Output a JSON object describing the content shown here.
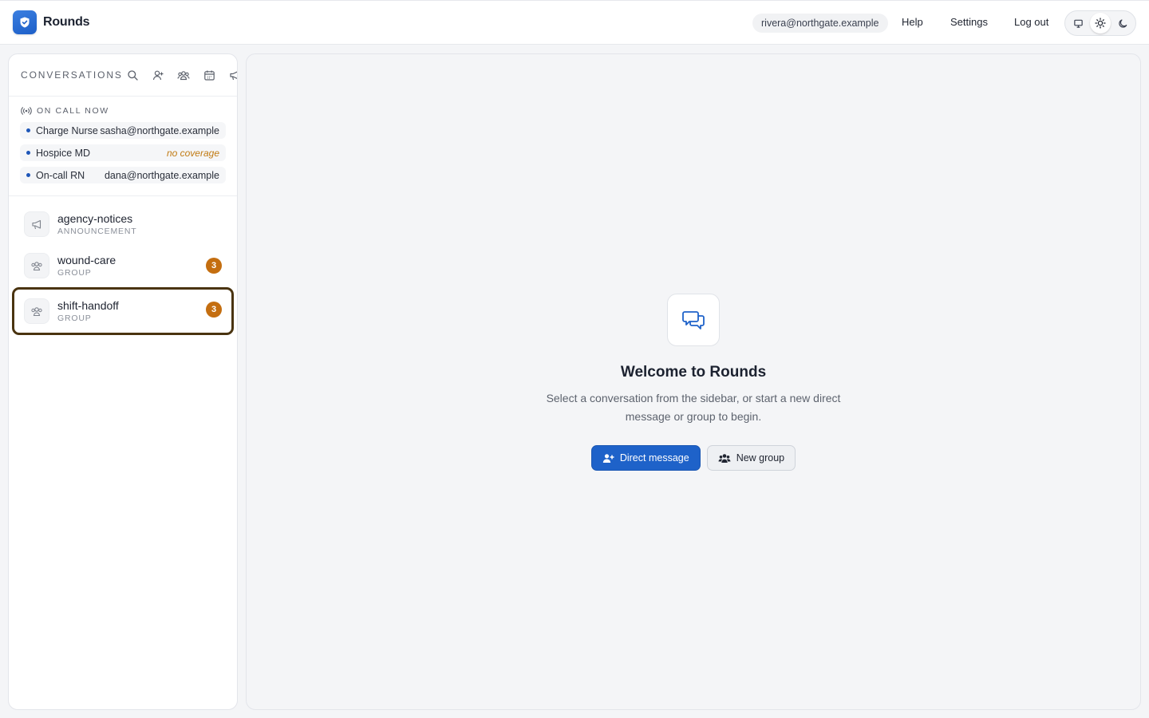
{
  "app": {
    "name": "Rounds"
  },
  "header": {
    "user_email": "rivera@northgate.example",
    "nav": {
      "help": "Help",
      "settings": "Settings",
      "logout": "Log out"
    },
    "theme_options": [
      "system",
      "light",
      "dark"
    ],
    "theme_selected": "light"
  },
  "sidebar": {
    "title": "CONVERSATIONS",
    "tools": [
      "search-icon",
      "new-direct-message-icon",
      "new-group-icon",
      "calendar-icon",
      "announcement-icon"
    ],
    "oncall": {
      "title": "ON CALL NOW",
      "rows": [
        {
          "role": "Charge Nurse",
          "value": "sasha@northgate.example",
          "warn": false
        },
        {
          "role": "Hospice MD",
          "value": "no coverage",
          "warn": true
        },
        {
          "role": "On-call RN",
          "value": "dana@northgate.example",
          "warn": false
        }
      ]
    },
    "conversations": [
      {
        "name": "agency-notices",
        "type": "ANNOUNCEMENT",
        "icon": "megaphone-icon",
        "unread": null,
        "selected": false
      },
      {
        "name": "wound-care",
        "type": "GROUP",
        "icon": "group-icon",
        "unread": "3",
        "selected": false
      },
      {
        "name": "shift-handoff",
        "type": "GROUP",
        "icon": "group-icon",
        "unread": "3",
        "selected": true
      }
    ]
  },
  "main": {
    "title": "Welcome to Rounds",
    "text": "Select a conversation from the sidebar, or start a new direct message or group to begin.",
    "primary_button": "Direct message",
    "secondary_button": "New group"
  },
  "colors": {
    "accent": "#1e62c9",
    "badge": "#c46e10",
    "warning": "#c07a12",
    "selected_border": "#4a3410"
  }
}
